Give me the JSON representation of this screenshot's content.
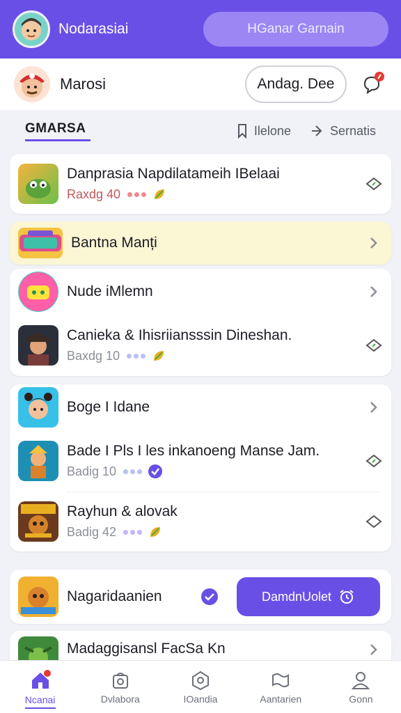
{
  "app": {
    "name": "Nodarasiai",
    "top_pill": "HGanar Garnain"
  },
  "profile": {
    "name": "Marosi",
    "button": "Andag. Dee"
  },
  "section": {
    "title": "GMARSA",
    "tool1": "Ilelone",
    "tool2": "Sernatis"
  },
  "items": [
    {
      "title": "Danprasia Napdilatameih IBelaai",
      "sub": "Raxdg 40"
    },
    {
      "title": "Bantna Manți"
    },
    {
      "title": "Nude iMlemn"
    },
    {
      "title": "Canieka & Ihisriiansssin Dineshan.",
      "sub": "Baxdg 10"
    },
    {
      "title": "Boge I Idane"
    },
    {
      "title": "Bade I Pls I les inkanoeng Manse Jam.",
      "sub": "Badig 10"
    },
    {
      "title": "Rayhun & alovak",
      "sub": "Badig 42"
    },
    {
      "title": "Nagaridaanien",
      "cta": "DamdnUolet"
    },
    {
      "title": "Madaggisansl FacSa Kn"
    }
  ],
  "nav": [
    {
      "label": "Ncanai"
    },
    {
      "label": "Dvlabora"
    },
    {
      "label": "IOandia"
    },
    {
      "label": "Aantarien"
    },
    {
      "label": "Gonn"
    }
  ],
  "colors": {
    "accent": "#6a4fe6",
    "notification": "#e53935",
    "highlight": "#fbf6d3"
  }
}
